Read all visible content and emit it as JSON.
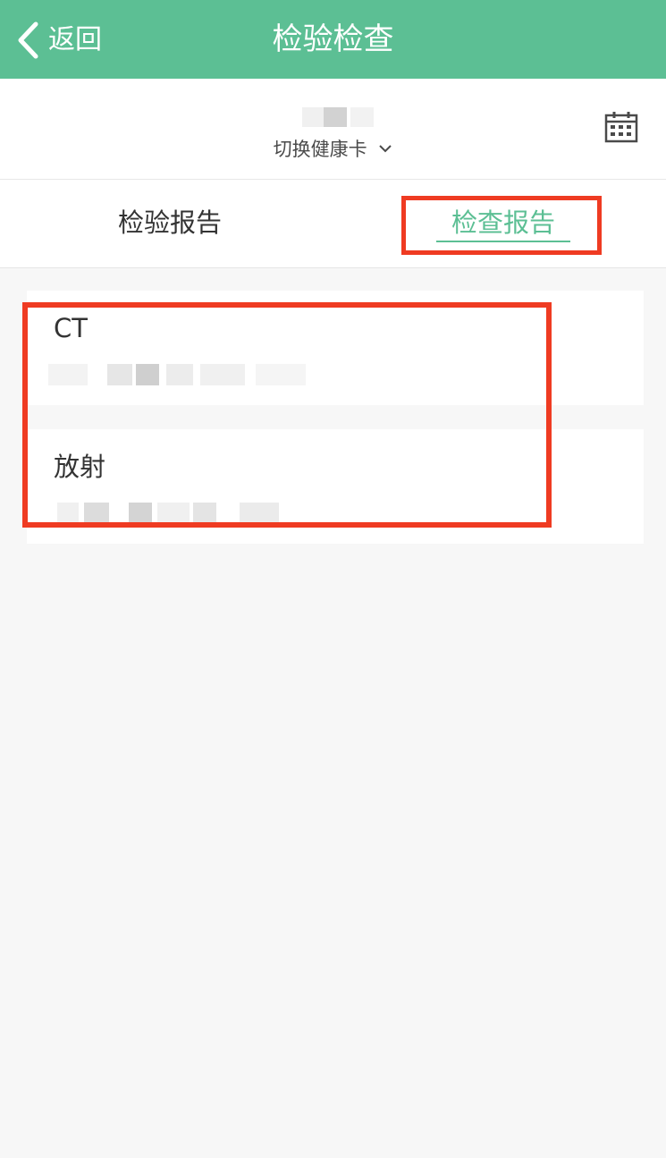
{
  "navbar": {
    "back_label": "返回",
    "title": "检验检查",
    "background": "#5cbf94"
  },
  "card_bar": {
    "switch_label": "切换健康卡",
    "calendar_icon": "calendar-icon"
  },
  "tabs": [
    {
      "label": "检验报告",
      "selected": false
    },
    {
      "label": "检查报告",
      "selected": true
    }
  ],
  "exam_items": [
    {
      "title": "CT"
    },
    {
      "title": "放射"
    }
  ],
  "colors": {
    "accent": "#5cbf94",
    "annotation": "#ef3b22",
    "page_background": "#f7f7f7"
  }
}
